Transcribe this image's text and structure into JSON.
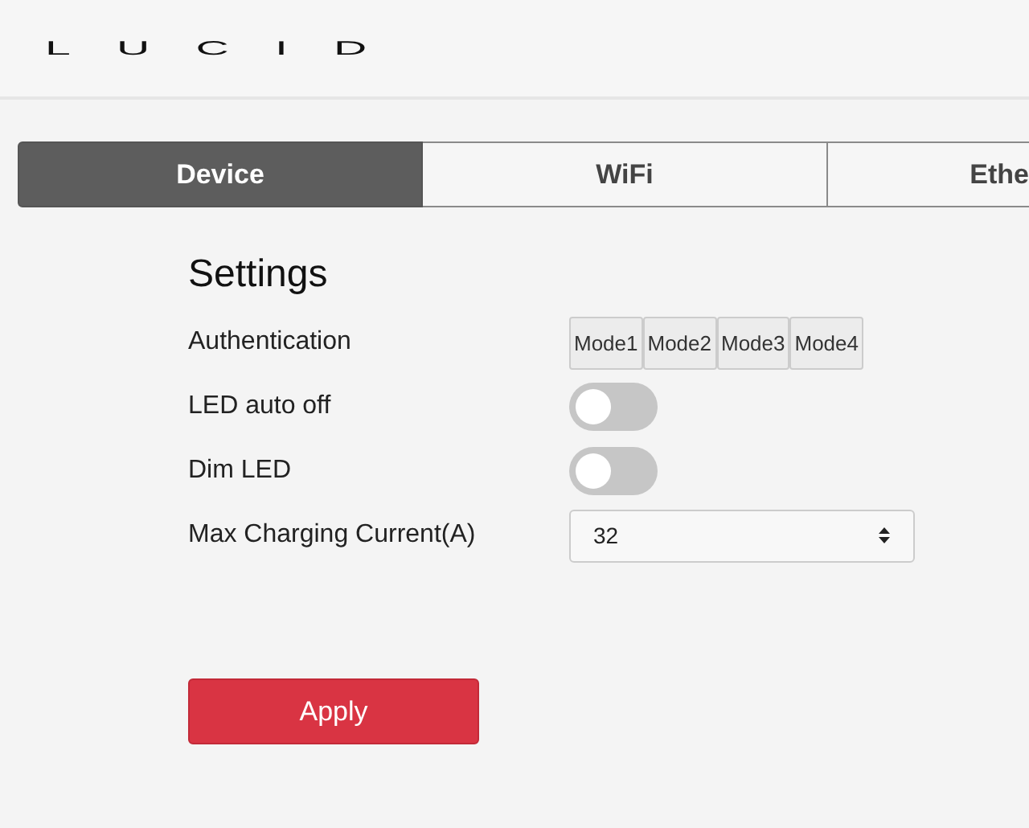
{
  "logo": "LUCID",
  "tabs": [
    {
      "label": "Device",
      "selected": true
    },
    {
      "label": "WiFi",
      "selected": false
    },
    {
      "label": "Ethe",
      "selected": false
    }
  ],
  "settings": {
    "title": "Settings",
    "rows": [
      {
        "kind": "modes",
        "label": "Authentication",
        "options": [
          "Mode1",
          "Mode2",
          "Mode3",
          "Mode4"
        ]
      },
      {
        "kind": "toggle",
        "label": "LED auto off",
        "on": false
      },
      {
        "kind": "toggle",
        "label": "Dim LED",
        "on": false
      },
      {
        "kind": "select",
        "label": "Max Charging Current(A)",
        "value": "32"
      }
    ]
  },
  "apply_button": "Apply"
}
